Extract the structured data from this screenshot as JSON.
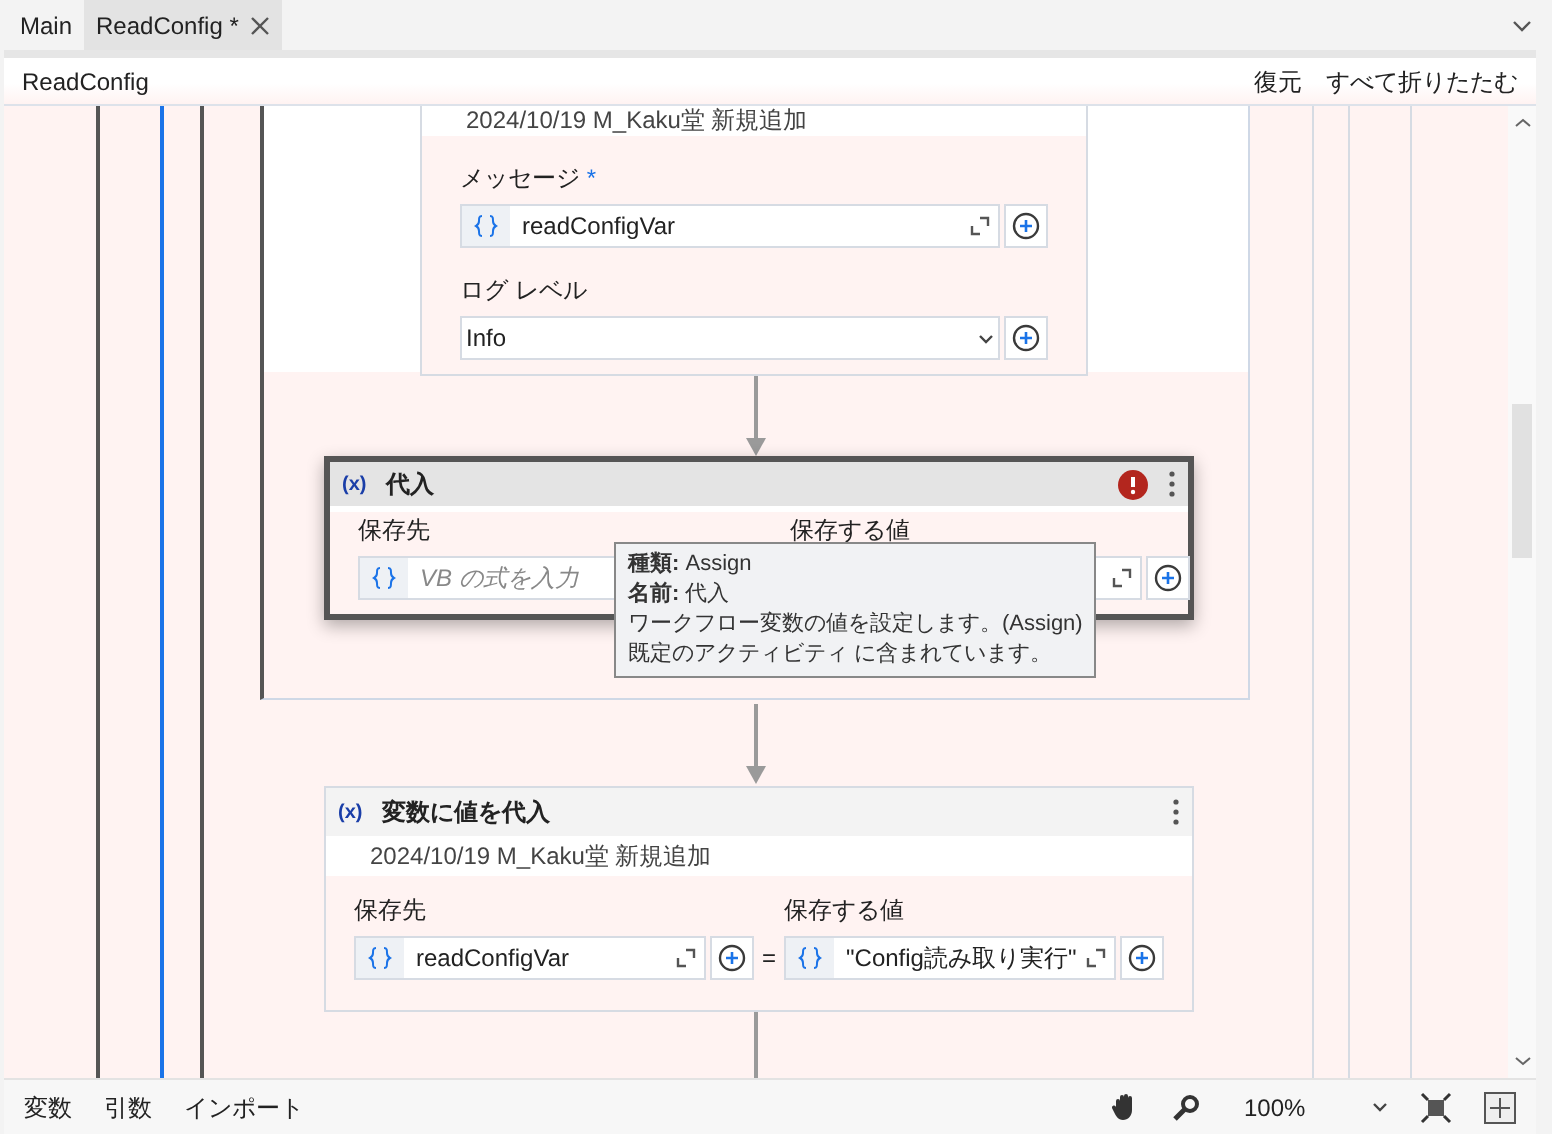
{
  "tabs": [
    {
      "label": "Main",
      "selected": false,
      "closable": false
    },
    {
      "label": "ReadConfig *",
      "selected": true,
      "closable": true
    }
  ],
  "breadcrumb": "ReadConfig",
  "toolbar_actions": [
    "復元",
    "すべて折りたたむ"
  ],
  "log_activity": {
    "annotation": "2024/10/19 M_Kaku堂 新規追加",
    "fields": [
      {
        "kind": "expression",
        "label": "メッセージ",
        "required_mark": "*",
        "value": "readConfigVar"
      },
      {
        "kind": "dropdown",
        "label": "ログ レベル",
        "value": "Info"
      }
    ]
  },
  "assign_activity": {
    "icon_text": "(x)",
    "title": "代入",
    "selected": true,
    "error": true,
    "target_label": "保存先",
    "value_label": "保存する値",
    "target_placeholder": "VB の式を入力"
  },
  "tooltip": {
    "lines": [
      "**種類:** Assign",
      "**名前:** 代入",
      "ワークフロー変数の値を設定します。(Assign)",
      "既定のアクティビティ に含まれています。"
    ]
  },
  "assign_activity_2": {
    "icon_text": "(x)",
    "title": "変数に値を代入",
    "selected": false,
    "annotation": "2024/10/19 M_Kaku堂 新規追加",
    "target_label": "保存先",
    "target_value": "readConfigVar",
    "equals": "=",
    "value_label": "保存する値",
    "value": "\"Config読み取り実行\""
  },
  "status_bar": {
    "panels": [
      "変数",
      "引数",
      "インポート"
    ],
    "zoom": "100%"
  }
}
